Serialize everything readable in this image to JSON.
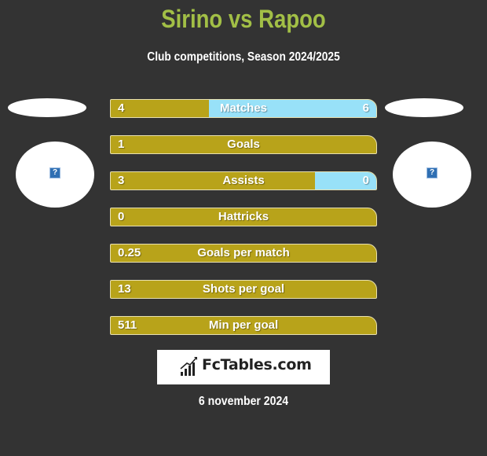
{
  "header": {
    "title": "Sirino vs Rapoo",
    "subtitle": "Club competitions, Season 2024/2025"
  },
  "teams": {
    "left": {
      "name": "Sirino",
      "logo_icon": "missing-image-icon",
      "logo_glyph": "?"
    },
    "right": {
      "name": "Rapoo",
      "logo_icon": "missing-image-icon",
      "logo_glyph": "?"
    }
  },
  "colors": {
    "title": "#a2bf46",
    "left_bar": "#b8a31a",
    "right_bar": "#98e1f8",
    "background": "#333333"
  },
  "stats": [
    {
      "label": "Matches",
      "left": "4",
      "right": "6",
      "right_share": 0.63
    },
    {
      "label": "Goals",
      "left": "1",
      "right": "",
      "right_share": 0
    },
    {
      "label": "Assists",
      "left": "3",
      "right": "0",
      "right_share": 0.23
    },
    {
      "label": "Hattricks",
      "left": "0",
      "right": "",
      "right_share": 0
    },
    {
      "label": "Goals per match",
      "left": "0.25",
      "right": "",
      "right_share": 0
    },
    {
      "label": "Shots per goal",
      "left": "13",
      "right": "",
      "right_share": 0
    },
    {
      "label": "Min per goal",
      "left": "511",
      "right": "",
      "right_share": 0
    }
  ],
  "footer": {
    "brand": "FcTables.com",
    "brand_icon": "bar-chart-icon",
    "date": "6 november 2024"
  }
}
